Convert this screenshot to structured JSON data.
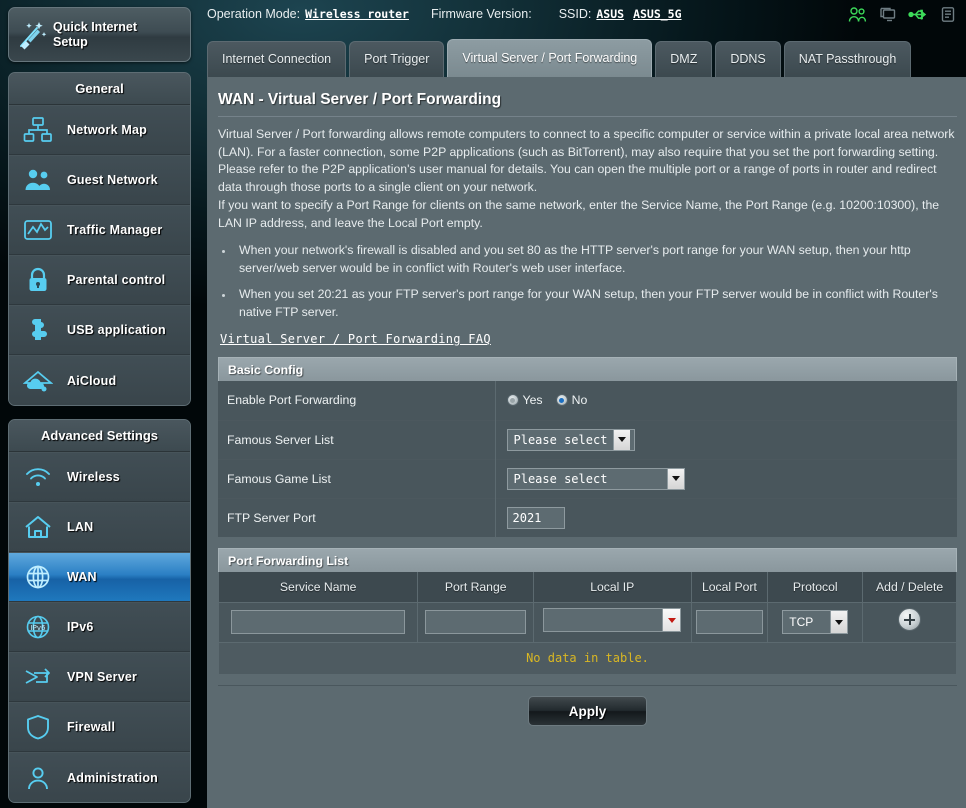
{
  "header": {
    "operation_mode_label": "Operation Mode:",
    "operation_mode_value": "Wireless router",
    "firmware_label": "Firmware Version:",
    "firmware_value": "",
    "ssid_label": "SSID:",
    "ssid_1": "ASUS",
    "ssid_2": "ASUS_5G",
    "icons": [
      "clients-users-icon",
      "monitors-icon",
      "usb-icon",
      "printer-icon"
    ]
  },
  "quick_setup": {
    "label_line1": "Quick Internet",
    "label_line2": "Setup",
    "icon": "magic-wand-icon"
  },
  "sidebar": {
    "general": {
      "title": "General",
      "items": [
        {
          "label": "Network Map",
          "icon": "network-map-icon"
        },
        {
          "label": "Guest Network",
          "icon": "guest-network-icon"
        },
        {
          "label": "Traffic Manager",
          "icon": "traffic-manager-icon"
        },
        {
          "label": "Parental control",
          "icon": "lock-icon"
        },
        {
          "label": "USB application",
          "icon": "puzzle-piece-icon"
        },
        {
          "label": "AiCloud",
          "icon": "cloud-icon"
        }
      ]
    },
    "advanced": {
      "title": "Advanced Settings",
      "items": [
        {
          "label": "Wireless",
          "icon": "wifi-icon",
          "active": false
        },
        {
          "label": "LAN",
          "icon": "home-icon",
          "active": false
        },
        {
          "label": "WAN",
          "icon": "globe-icon",
          "active": true
        },
        {
          "label": "IPv6",
          "icon": "ipv6-globe-icon",
          "active": false
        },
        {
          "label": "VPN Server",
          "icon": "vpn-key-icon",
          "active": false
        },
        {
          "label": "Firewall",
          "icon": "shield-icon",
          "active": false
        },
        {
          "label": "Administration",
          "icon": "user-icon",
          "active": false
        }
      ]
    }
  },
  "tabs": [
    {
      "label": "Internet Connection",
      "active": false
    },
    {
      "label": "Port Trigger",
      "active": false
    },
    {
      "label": "Virtual Server / Port Forwarding",
      "active": true
    },
    {
      "label": "DMZ",
      "active": false
    },
    {
      "label": "DDNS",
      "active": false
    },
    {
      "label": "NAT Passthrough",
      "active": false
    }
  ],
  "page": {
    "title": "WAN - Virtual Server / Port Forwarding",
    "paragraph_1": "Virtual Server / Port forwarding allows remote computers to connect to a specific computer or service within a private local area network (LAN). For a faster connection, some P2P applications (such as BitTorrent), may also require that you set the port forwarding setting. Please refer to the P2P application's user manual for details. You can open the multiple port or a range of ports in router and redirect data through those ports to a single client on your network.",
    "paragraph_2": "If you want to specify a Port Range for clients on the same network, enter the Service Name, the Port Range (e.g. 10200:10300), the LAN IP address, and leave the Local Port empty.",
    "notes": [
      "When your network's firewall is disabled and you set 80 as the HTTP server's port range for your WAN setup, then your http server/web server would be in conflict with Router's web user interface.",
      "When you set 20:21 as your FTP server's port range for your WAN setup, then your FTP server would be in conflict with Router's native FTP server."
    ],
    "faq_link": "Virtual Server / Port Forwarding FAQ"
  },
  "basic_config": {
    "title": "Basic Config",
    "rows": [
      {
        "label": "Enable Port Forwarding",
        "type": "radio",
        "options": [
          "Yes",
          "No"
        ],
        "selected": "No"
      },
      {
        "label": "Famous Server List",
        "type": "select",
        "value": "Please select"
      },
      {
        "label": "Famous Game List",
        "type": "select",
        "value": "Please select"
      },
      {
        "label": "FTP Server Port",
        "type": "text",
        "value": "2021"
      }
    ]
  },
  "port_forwarding_list": {
    "title": "Port Forwarding List",
    "columns": [
      "Service Name",
      "Port Range",
      "Local IP",
      "Local Port",
      "Protocol",
      "Add / Delete"
    ],
    "entry_row": {
      "service_name": "",
      "port_range": "",
      "local_ip": "",
      "local_port": "",
      "protocol": "TCP",
      "add_icon": "plus-circle-icon"
    },
    "empty_message": "No data in table."
  },
  "footer": {
    "apply_label": "Apply"
  },
  "colors": {
    "accent_blue": "#2b7fc4",
    "panel_bg": "#5c6a70",
    "row_bg": "#49565c",
    "warning_yellow": "#d9b723",
    "icon_cyan": "#6fd6f5"
  }
}
